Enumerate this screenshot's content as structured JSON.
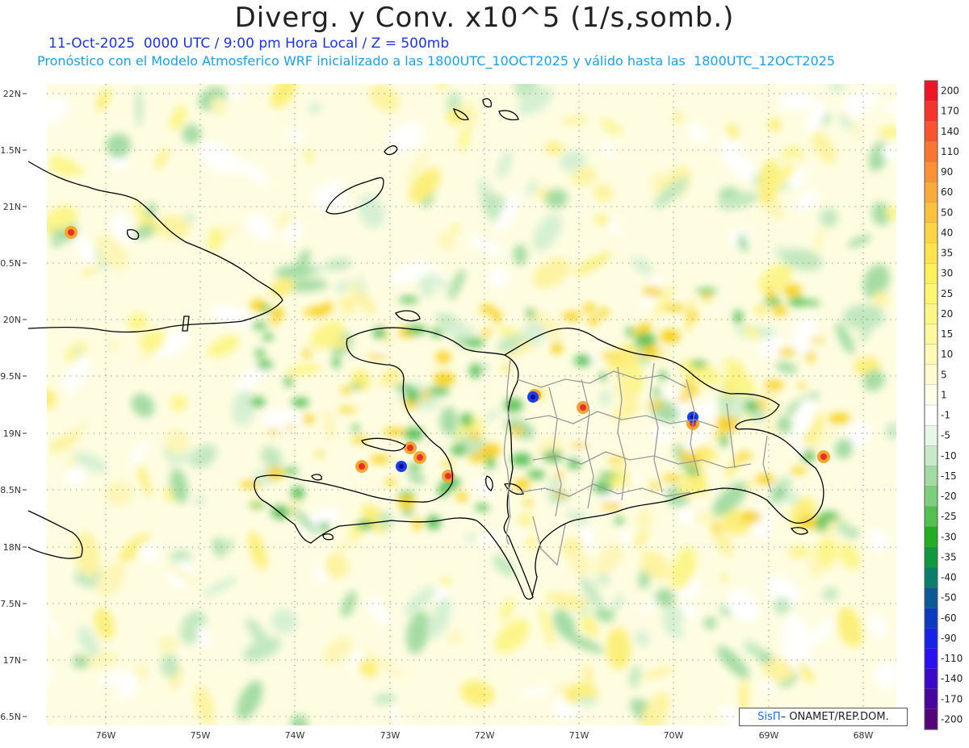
{
  "title": "Diverg. y Conv. x10^5 (1/s,somb.)",
  "subtitle_line1": "11-Oct-2025  0000 UTC / 9:00 pm Hora Local / Z = 500mb",
  "subtitle_line2": "Pronóstico con el Modelo Atmosferico WRF inicializado a las 1800UTC_10OCT2025 y válido hasta las  1800UTC_12OCT2025",
  "lat_labels": [
    "22N",
    "1.5N",
    "21N",
    "0.5N",
    "20N",
    "9.5N",
    "19N",
    "8.5N",
    "18N",
    "7.5N",
    "17N",
    "6.5N"
  ],
  "lon_labels": [
    "76W",
    "75W",
    "74W",
    "73W",
    "72W",
    "71W",
    "70W",
    "69W",
    "68W"
  ],
  "colorbar": {
    "labels": [
      "200",
      "170",
      "140",
      "110",
      "90",
      "60",
      "50",
      "40",
      "35",
      "30",
      "25",
      "20",
      "15",
      "10",
      "5",
      "1",
      "-1",
      "-5",
      "-10",
      "-15",
      "-20",
      "-25",
      "-30",
      "-35",
      "-40",
      "-50",
      "-60",
      "-90",
      "-110",
      "-140",
      "-170",
      "-200"
    ],
    "colors": [
      "#f0142a",
      "#f5342a",
      "#f8552e",
      "#fa7432",
      "#fb9236",
      "#fcab3a",
      "#fdc13e",
      "#fed645",
      "#fee34f",
      "#fdf05a",
      "#fcf76e",
      "#fbf785",
      "#fbf99c",
      "#fcfab5",
      "#fdfbcf",
      "#fefde8",
      "#ffffff",
      "#e9f7e9",
      "#c7ebc6",
      "#a2dca2",
      "#7cd07c",
      "#52c152",
      "#22ae22",
      "#0e9a3c",
      "#0a7e6a",
      "#0a5a96",
      "#0b3cc0",
      "#1622e6",
      "#2a10f0",
      "#3a0ac8",
      "#48069e",
      "#52067a"
    ]
  },
  "credit": {
    "sis": "SisΠ",
    "text": "– ONAMET/REP.DOM."
  }
}
